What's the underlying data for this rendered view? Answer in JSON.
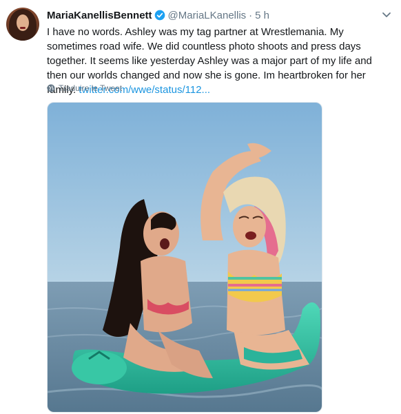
{
  "tweet": {
    "display_name": "MariaKanellisBennett",
    "handle": "@MariaLKanellis",
    "separator": "·",
    "time": "5 h",
    "text_main": "I have no words. Ashley was my tag partner at Wrestlemania. My sometimes road wife. We did countless photo shoots and press days together. It seems like yesterday Ashley was a major part of my life and then our worlds changed and now she is gone. Im heartbroken for her family. ",
    "link_text": "twitter.com/wwe/status/112...",
    "translate_label": "Traduire le Tweet"
  },
  "icons": {
    "verified": "verified-badge-icon",
    "caret": "chevron-down-icon",
    "translate": "globe-icon"
  },
  "colors": {
    "link": "#1b95e0",
    "muted": "#657786",
    "verified": "#1da1f2",
    "text": "#14171a"
  }
}
